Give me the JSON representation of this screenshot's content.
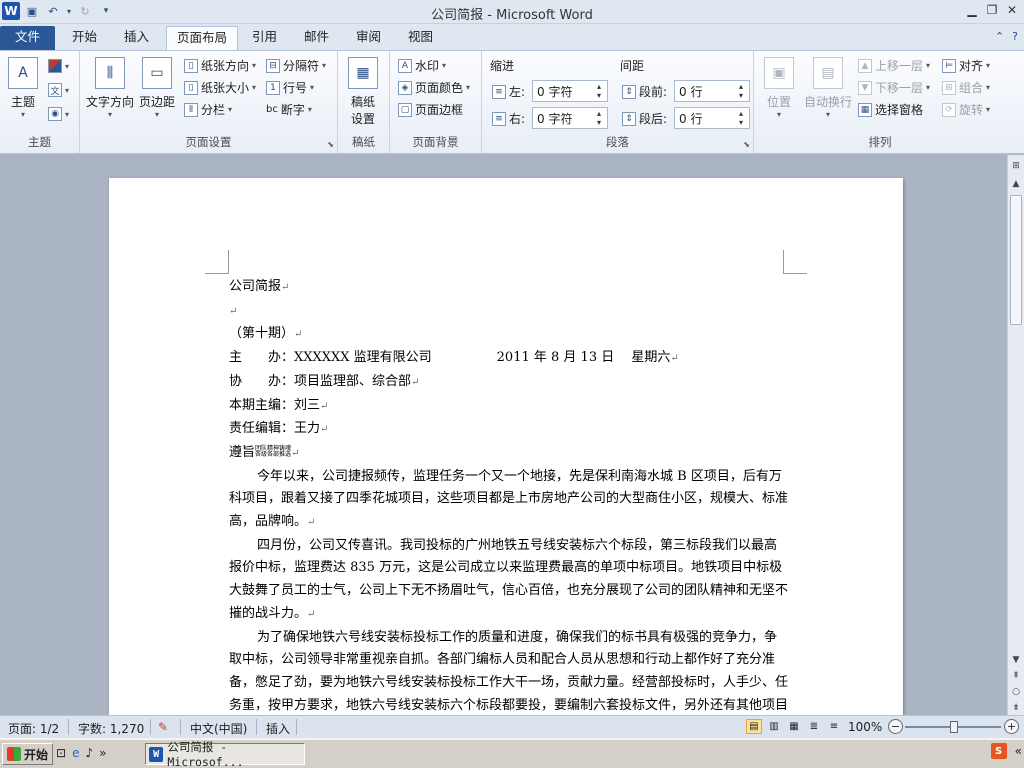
{
  "window": {
    "title": "公司简报 - Microsoft Word"
  },
  "qat": {
    "logo": "W"
  },
  "tabs": [
    {
      "label": "文件"
    },
    {
      "label": "开始"
    },
    {
      "label": "插入"
    },
    {
      "label": "页面布局"
    },
    {
      "label": "引用"
    },
    {
      "label": "邮件"
    },
    {
      "label": "审阅"
    },
    {
      "label": "视图"
    }
  ],
  "ribbon": {
    "theme": {
      "label": "主题",
      "btn": "主题",
      "colors_icon": "theme-colors-icon",
      "fonts_icon": "文",
      "effects_icon": "theme-effects-icon"
    },
    "page_setup": {
      "label": "页面设置",
      "text_direction": "文字方向",
      "margins": "页边距",
      "orientation": "纸张方向",
      "size": "纸张大小",
      "columns": "分栏",
      "breaks": "分隔符",
      "line_numbers": "行号",
      "hyphenation": "断字",
      "hyphenation_icon": "bc"
    },
    "manuscript": {
      "label": "稿纸",
      "btn": "稿纸\n设置",
      "btn_l1": "稿纸",
      "btn_l2": "设置"
    },
    "background": {
      "label": "页面背景",
      "watermark": "水印",
      "page_color": "页面颜色",
      "page_borders": "页面边框"
    },
    "paragraph": {
      "label": "段落",
      "indent_title": "缩进",
      "spacing_title": "间距",
      "left_label": "左:",
      "left_value": "0 字符",
      "right_label": "右:",
      "right_value": "0 字符",
      "before_label": "段前:",
      "before_value": "0 行",
      "after_label": "段后:",
      "after_value": "0 行"
    },
    "arrange": {
      "label": "排列",
      "position": "位置",
      "wrap": "自动换行",
      "bring_forward": "上移一层",
      "send_backward": "下移一层",
      "selection_pane": "选择窗格",
      "align": "对齐",
      "group": "组合",
      "rotate": "旋转"
    }
  },
  "document": {
    "lines": [
      "公司简报",
      "",
      "（第十期）",
      "主　　办：XXXXXX 监理有限公司　　　　　2011 年 8 月 13 日　 星期六",
      "协　　办：项目监理部、综合部",
      "本期主编：刘三",
      "责任编辑：王力"
    ],
    "motto_label": "遵旨",
    "motto_l1": "团队精神铸魂",
    "motto_l2": "各级各部推选",
    "para1": "今年以来，公司捷报频传，监理任务一个又一个地接，先是保利南海水城 B 区项目，后有万科项目，跟着又接了四季花城项目，这些项目都是上市房地产公司的大型商住小区，规模大、标准高，品牌响。",
    "para2": "四月份，公司又传喜讯。我司投标的广州地铁五号线安装标六个标段，第三标段我们以最高报价中标，监理费达 835 万元，这是公司成立以来监理费最高的单项中标项目。地铁项目中标极大鼓舞了员工的士气，公司上下无不扬眉吐气，信心百倍，也充分展现了公司的团队精神和无坚不摧的战斗力。",
    "para3": "为了确保地铁六号线安装标投标工作的质量和进度，确保我们的标书具有极强的竞争力，争取中标，公司领导非常重视亲自抓。各部门编标人员和配合人员从思想和行动上都作好了充分准备，憋足了劲，要为地铁六号线安装标投标工作大干一场，贡献力量。经营部投标时，人手少、任务重，按甲方要求，地铁六号线安装标六个标段都要投，要编制六套投标文件，另外还有其他项目要投标，他们夜以继日地工作，身体不舒服也没时间去拿药，靠着一股拼搏的精神坚持了下来。",
    "para_mark": "↵"
  },
  "status": {
    "page": "页面: 1/2",
    "words": "字数: 1,270",
    "language": "中文(中国)",
    "mode": "插入",
    "zoom": "100%",
    "zoom_level": 1.0
  },
  "taskbar": {
    "start": "开始",
    "task": "公司简报 - Microsof...",
    "more": "»",
    "tray_icon": "S",
    "tray_more": "«"
  }
}
